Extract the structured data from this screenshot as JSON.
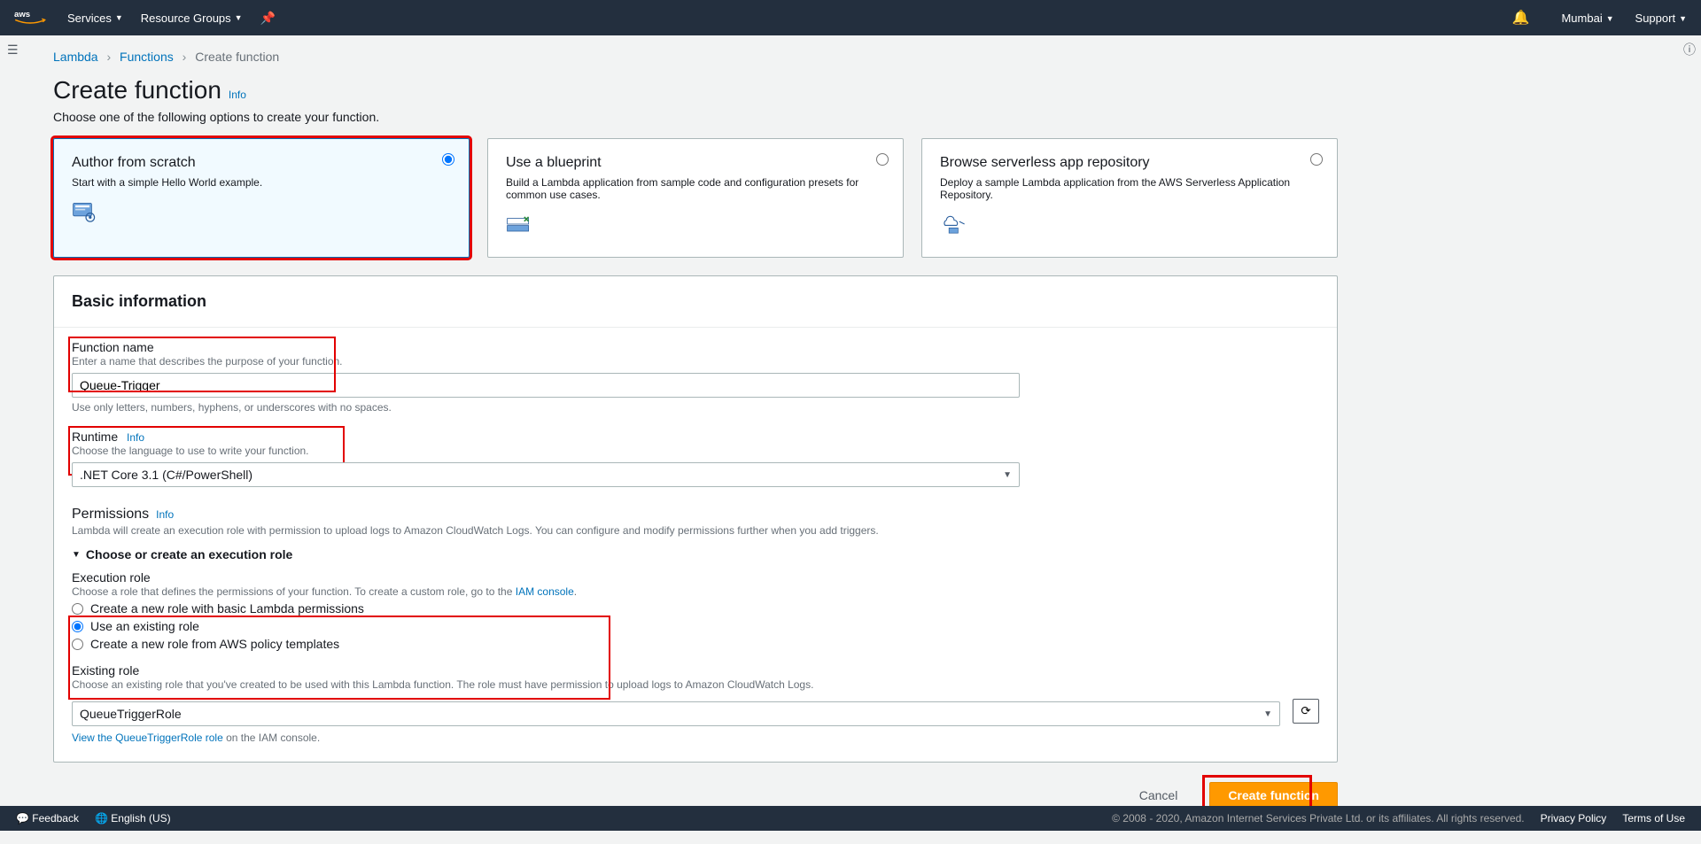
{
  "nav": {
    "services": "Services",
    "resourceGroups": "Resource Groups",
    "region": "Mumbai",
    "support": "Support"
  },
  "breadcrumb": {
    "lambda": "Lambda",
    "functions": "Functions",
    "createFunction": "Create function"
  },
  "page": {
    "title": "Create function",
    "infoLabel": "Info",
    "subtitle": "Choose one of the following options to create your function."
  },
  "options": [
    {
      "title": "Author from scratch",
      "desc": "Start with a simple Hello World example.",
      "selected": true
    },
    {
      "title": "Use a blueprint",
      "desc": "Build a Lambda application from sample code and configuration presets for common use cases.",
      "selected": false
    },
    {
      "title": "Browse serverless app repository",
      "desc": "Deploy a sample Lambda application from the AWS Serverless Application Repository.",
      "selected": false
    }
  ],
  "basicInfo": {
    "heading": "Basic information",
    "fnName": {
      "label": "Function name",
      "sublabel": "Enter a name that describes the purpose of your function.",
      "value": "Queue-Trigger",
      "hint": "Use only letters, numbers, hyphens, or underscores with no spaces."
    },
    "runtime": {
      "label": "Runtime",
      "info": "Info",
      "sublabel": "Choose the language to use to write your function.",
      "value": ".NET Core 3.1 (C#/PowerShell)"
    },
    "permissions": {
      "label": "Permissions",
      "info": "Info",
      "desc": "Lambda will create an execution role with permission to upload logs to Amazon CloudWatch Logs. You can configure and modify permissions further when you add triggers.",
      "toggle": "Choose or create an execution role",
      "executionRoleLabel": "Execution role",
      "executionRoleDescPrefix": "Choose a role that defines the permissions of your function. To create a custom role, go to the ",
      "iamConsole": "IAM console",
      "radios": {
        "createBasic": "Create a new role with basic Lambda permissions",
        "useExisting": "Use an existing role",
        "createFromTemplate": "Create a new role from AWS policy templates"
      },
      "existingRole": {
        "label": "Existing role",
        "desc": "Choose an existing role that you've created to be used with this Lambda function. The role must have permission to upload logs to Amazon CloudWatch Logs.",
        "value": "QueueTriggerRole",
        "viewLink": "View the QueueTriggerRole role",
        "viewSuffix": " on the IAM console."
      }
    }
  },
  "actions": {
    "cancel": "Cancel",
    "create": "Create function"
  },
  "footer": {
    "feedback": "Feedback",
    "language": "English (US)",
    "copyright": "© 2008 - 2020, Amazon Internet Services Private Ltd. or its affiliates. All rights reserved.",
    "privacy": "Privacy Policy",
    "terms": "Terms of Use"
  }
}
